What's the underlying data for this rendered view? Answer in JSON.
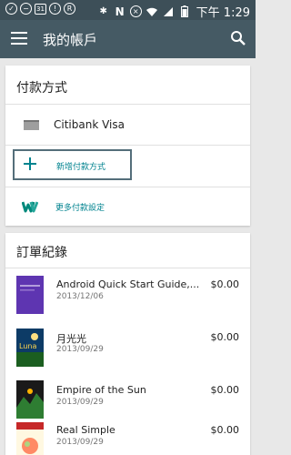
{
  "status_bar": {
    "time": "下午 1:29"
  },
  "app_bar": {
    "title": "我的帳戶"
  },
  "payment": {
    "title": "付款方式",
    "card_name": "Citibank Visa",
    "add_label": "新增付款方式",
    "more_label": "更多付款設定"
  },
  "orders": {
    "title": "訂單紀錄",
    "items": [
      {
        "title": "Android Quick Start Guide,...",
        "date": "2013/12/06",
        "price": "$0.00"
      },
      {
        "title": "月光光",
        "date": "2013/09/29",
        "price": "$0.00"
      },
      {
        "title": "Empire of the Sun",
        "date": "2013/09/29",
        "price": "$0.00"
      },
      {
        "title": "Real Simple",
        "date": "2013/09/29",
        "price": "$0.00"
      }
    ]
  },
  "colors": {
    "app_bar": "#455a64",
    "status_bar": "#3d4f58",
    "accent": "#00838f"
  }
}
